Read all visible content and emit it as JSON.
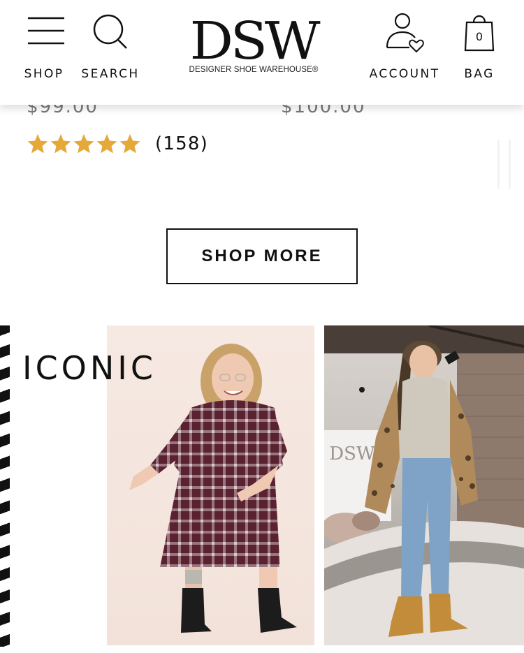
{
  "header": {
    "shop_label": "SHOP",
    "search_label": "SEARCH",
    "account_label": "ACCOUNT",
    "bag_label": "BAG",
    "bag_count": "0",
    "logo_main": "DSW",
    "logo_sub": "DESIGNER SHOE WAREHOUSE®"
  },
  "products": {
    "left_price": "$99.00",
    "right_price": "$100.00",
    "rating_count": "(158)",
    "rating_stars": 5
  },
  "cta": {
    "shop_more_label": "SHOP MORE"
  },
  "iconic": {
    "title": "ICONIC",
    "photo2_sign_logo": "DSW"
  },
  "colors": {
    "star": "#e5a93a",
    "text": "#111111",
    "price": "#777777"
  }
}
